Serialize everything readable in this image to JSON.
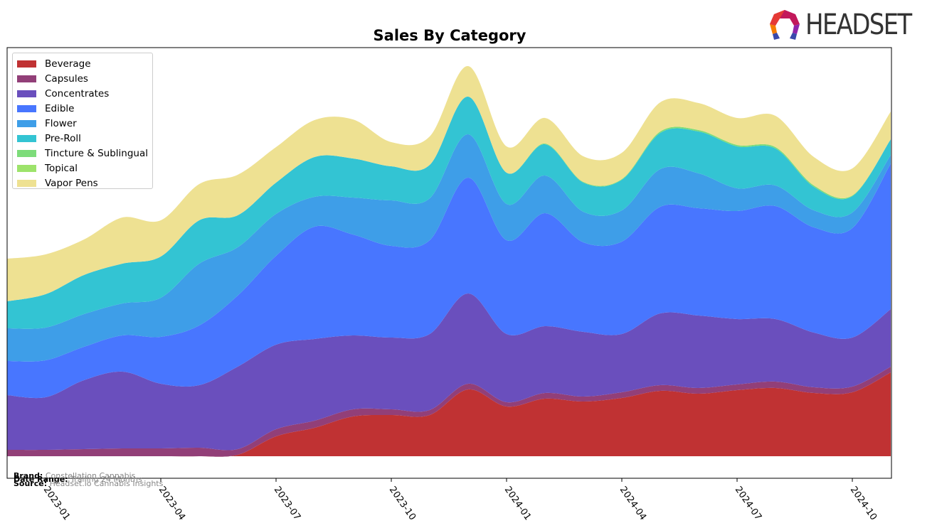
{
  "logo": {
    "text": "HEADSET"
  },
  "footer": {
    "brand_label": "Brand:",
    "brand_value": "Constellation Cannabis",
    "date_label": "Date Range:",
    "date_value": "Trailing 24 Months",
    "source_label": "Source:",
    "source_value": "Headset.io Cannabis Insights"
  },
  "chart_data": {
    "type": "area",
    "stacked": true,
    "title": "Sales By Category",
    "xlabel": "",
    "ylabel": "",
    "y_ticks_shown": false,
    "grid": false,
    "legend_position": "top-left",
    "x": [
      "2022-12",
      "2023-01",
      "2023-02",
      "2023-03",
      "2023-04",
      "2023-05",
      "2023-06",
      "2023-07",
      "2023-08",
      "2023-09",
      "2023-10",
      "2023-11",
      "2023-12",
      "2024-01",
      "2024-02",
      "2024-03",
      "2024-04",
      "2024-05",
      "2024-06",
      "2024-07",
      "2024-08",
      "2024-09",
      "2024-10",
      "2024-11"
    ],
    "x_tick_labels": [
      "2023-01",
      "2023-04",
      "2023-07",
      "2023-10",
      "2024-01",
      "2024-04",
      "2024-07",
      "2024-10"
    ],
    "series": [
      {
        "name": "Beverage",
        "color": "#c03233",
        "values": [
          0,
          0,
          0,
          0,
          0,
          0,
          0.2,
          2.8,
          4.0,
          5.6,
          5.8,
          5.8,
          9.4,
          7.0,
          8.1,
          7.7,
          8.2,
          9.2,
          8.8,
          9.3,
          9.6,
          8.9,
          9.0,
          11.8
        ]
      },
      {
        "name": "Capsules",
        "color": "#923f78",
        "values": [
          0.9,
          0.9,
          1.0,
          1.1,
          1.1,
          1.2,
          0.8,
          1.0,
          1.0,
          1.0,
          0.8,
          0.7,
          0.8,
          0.6,
          0.8,
          0.7,
          0.8,
          0.8,
          0.8,
          0.8,
          0.9,
          0.8,
          0.8,
          0.8
        ]
      },
      {
        "name": "Concentrates",
        "color": "#6a4fbd",
        "values": [
          7.7,
          7.4,
          9.7,
          10.8,
          9.1,
          8.8,
          11.6,
          11.9,
          11.5,
          10.4,
          10.1,
          10.7,
          12.7,
          9.6,
          9.4,
          9.1,
          8.2,
          10.1,
          10.2,
          9.2,
          8.8,
          7.7,
          6.9,
          8.1
        ]
      },
      {
        "name": "Edible",
        "color": "#4876ff",
        "values": [
          4.8,
          5.2,
          4.7,
          5.1,
          6.6,
          8.4,
          10.0,
          12.5,
          15.8,
          14.2,
          12.9,
          13.2,
          16.3,
          13.2,
          15.9,
          12.6,
          13.0,
          15.0,
          15.1,
          15.2,
          15.9,
          14.8,
          15.4,
          20.5
        ]
      },
      {
        "name": "Flower",
        "color": "#3e9ee8",
        "values": [
          4.6,
          4.6,
          4.6,
          4.5,
          5.5,
          8.7,
          6.8,
          5.9,
          4.2,
          5.2,
          6.4,
          5.9,
          6.1,
          5.1,
          5.3,
          4.3,
          4.4,
          5.3,
          4.9,
          3.2,
          2.9,
          2.4,
          2.2,
          1.2
        ]
      },
      {
        "name": "Pre-Roll",
        "color": "#33c4d3",
        "values": [
          3.8,
          4.7,
          5.5,
          5.6,
          5.8,
          6.1,
          4.5,
          4.4,
          5.6,
          5.5,
          4.8,
          4.7,
          5.3,
          4.4,
          4.4,
          4.1,
          4.3,
          5.1,
          5.9,
          5.9,
          5.2,
          3.3,
          2.3,
          2.2
        ]
      },
      {
        "name": "Tincture & Sublingual",
        "color": "#7ddc7a",
        "values": [
          0,
          0,
          0,
          0,
          0,
          0,
          0,
          0,
          0,
          0,
          0,
          0,
          0,
          0,
          0.1,
          0.1,
          0.1,
          0.2,
          0.2,
          0.2,
          0.2,
          0.2,
          0.1,
          0
        ]
      },
      {
        "name": "Topical",
        "color": "#9de36b",
        "values": [
          0,
          0,
          0,
          0,
          0,
          0,
          0,
          0,
          0,
          0,
          0,
          0,
          0,
          0,
          0,
          0,
          0,
          0,
          0,
          0,
          0,
          0,
          0,
          0
        ]
      },
      {
        "name": "Vapor Pens",
        "color": "#eee192",
        "values": [
          6.0,
          5.6,
          5.0,
          6.5,
          5.1,
          5.1,
          5.7,
          5.0,
          5.2,
          5.5,
          3.4,
          4.0,
          4.3,
          3.7,
          3.6,
          3.6,
          3.7,
          4.1,
          3.8,
          3.8,
          4.4,
          4.0,
          3.8,
          3.9
        ]
      }
    ]
  }
}
